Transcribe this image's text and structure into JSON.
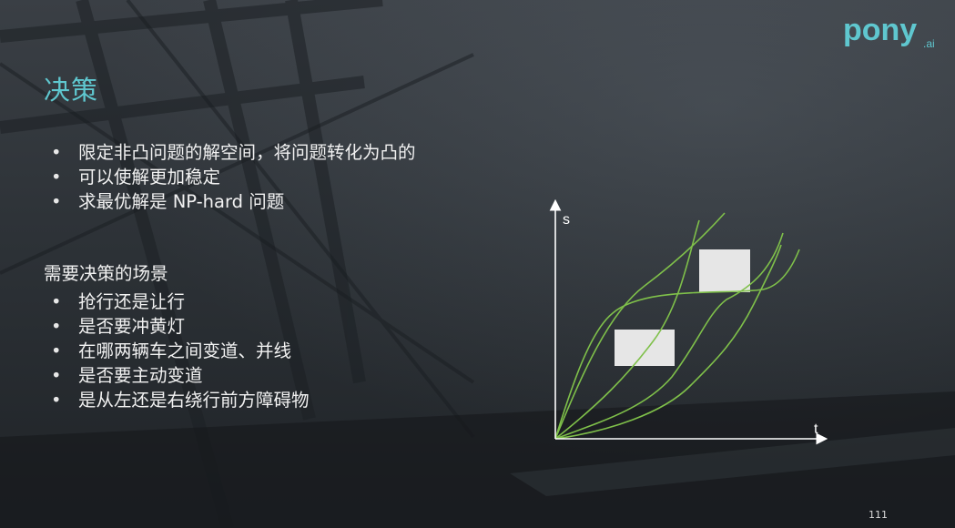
{
  "slide": {
    "title": "决策",
    "bullets_main": [
      "限定非凸问题的解空间，将问题转化为凸的",
      "可以使解更加稳定",
      "求最优解是 NP-hard 问题"
    ],
    "scenarios_heading": "需要决策的场景",
    "bullets_scenarios": [
      "抢行还是让行",
      "是否要冲黄灯",
      "在哪两辆车之间变道、并线",
      "是否要主动变道",
      "是从左还是右绕行前方障碍物"
    ],
    "page_number": "111",
    "bullet_glyph": "•"
  },
  "logo": {
    "text_main": "pony",
    "text_sub": ".ai",
    "color": "#5fc7cf"
  },
  "diagram": {
    "x_label": "t",
    "y_label": "s",
    "axis_color": "#ffffff",
    "curve_color": "#7fc04a",
    "obstacle_color": "#e6e6e6"
  }
}
